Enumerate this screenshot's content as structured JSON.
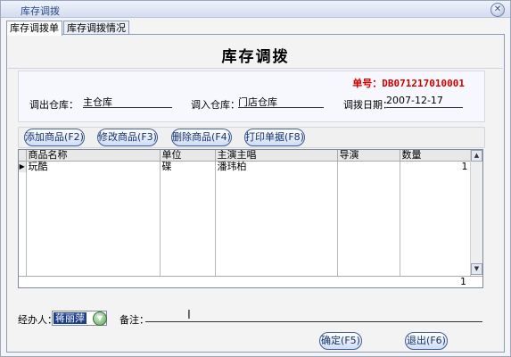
{
  "window": {
    "title": "库存调拨",
    "close_icon": "close-icon"
  },
  "tabs": [
    {
      "label": "库存调拨单",
      "active": true
    },
    {
      "label": "库存调拨情况",
      "active": false
    }
  ],
  "form": {
    "title": "库存调拨",
    "doc_number_label": "单号：",
    "doc_number_value": "DB071217010001",
    "out_warehouse_label": "调出仓库：",
    "out_warehouse_value": "主仓库",
    "in_warehouse_label": "调入仓库：",
    "in_warehouse_value": "门店仓库",
    "date_label": "调拨日期：",
    "date_value": "2007-12-17"
  },
  "toolbar": {
    "add_label": "添加商品(F2)",
    "edit_label": "修改商品(F3)",
    "delete_label": "删除商品(F4)",
    "print_label": "打印单据(F8)"
  },
  "grid": {
    "columns": [
      "商品名称",
      "单位",
      "主演主唱",
      "导演",
      "数量"
    ],
    "rows": [
      {
        "name": "玩酷",
        "unit": "碟",
        "singer": "潘玮柏",
        "director": "",
        "qty": "1"
      }
    ],
    "footer_total": "1"
  },
  "bottom": {
    "handler_label": "经办人：",
    "handler_value": "蒋丽萍",
    "remark_label": "备注：",
    "confirm_label": "确定(F5)",
    "exit_label": "退出(F6)"
  }
}
